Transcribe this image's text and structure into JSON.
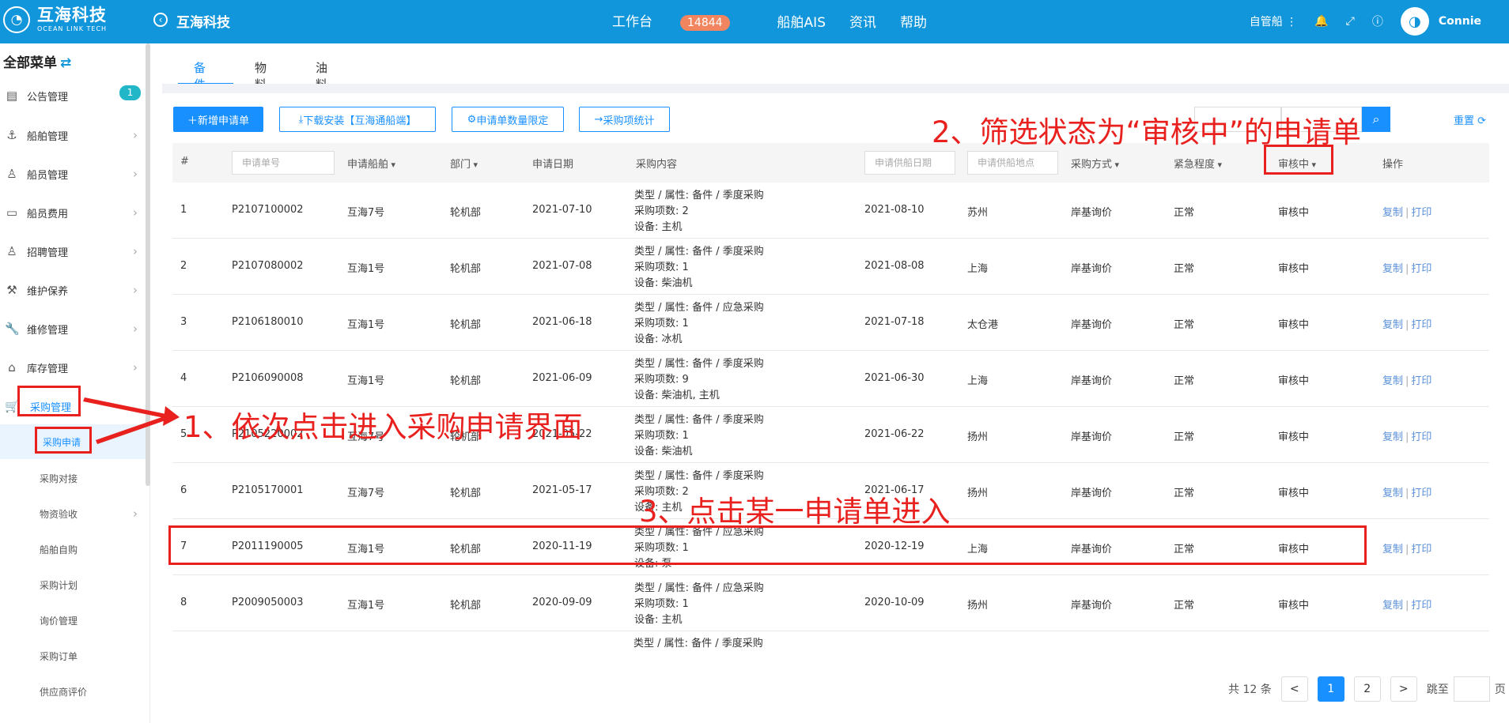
{
  "header": {
    "logo_cn": "互海科技",
    "logo_en": "OCEAN LINK TECH",
    "company": "互海科技",
    "nav": {
      "workbench": "工作台",
      "workbench_badge": "14844",
      "ais": "船舶AIS",
      "news": "资讯",
      "help": "帮助"
    },
    "tool": "自管船",
    "user": "Connie"
  },
  "sidebar": {
    "title": "全部菜单",
    "items": [
      {
        "label": "公告管理",
        "count": "1"
      },
      {
        "label": "船舶管理"
      },
      {
        "label": "船员管理"
      },
      {
        "label": "船员费用"
      },
      {
        "label": "招聘管理"
      },
      {
        "label": "维护保养"
      },
      {
        "label": "维修管理"
      },
      {
        "label": "库存管理"
      },
      {
        "label": "采购管理"
      }
    ],
    "subitems": [
      "采购申请",
      "采购对接",
      "物资验收",
      "船舶自购",
      "采购计划",
      "询价管理",
      "采购订单",
      "供应商评价"
    ]
  },
  "tabs": [
    "备件",
    "物料",
    "油料"
  ],
  "toolbar": {
    "new": "新增申请单",
    "download": "下载安装【互海通船端】",
    "limit": "申请单数量限定",
    "stats": "采购项统计",
    "reset": "重置"
  },
  "table": {
    "headers": {
      "index": "#",
      "order_placeholder": "申请单号",
      "ship": "申请船舶",
      "dept": "部门",
      "date": "申请日期",
      "content": "采购内容",
      "supply_date_placeholder": "申请供船日期",
      "supply_place_placeholder": "申请供船地点",
      "method": "采购方式",
      "urgency": "紧急程度",
      "status": "审核中",
      "ops": "操作"
    },
    "rows": [
      {
        "index": "1",
        "order": "P2107100002",
        "ship": "互海7号",
        "dept": "轮机部",
        "date": "2021-07-10",
        "c1": "类型 / 属性:  备件 / 季度采购",
        "c2": "采购项数:  2",
        "c3": "设备:   主机",
        "supply_date": "2021-08-10",
        "place": "苏州",
        "method": "岸基询价",
        "urgency": "正常",
        "status": "审核中",
        "copy": "复制",
        "print": "打印"
      },
      {
        "index": "2",
        "order": "P2107080002",
        "ship": "互海1号",
        "dept": "轮机部",
        "date": "2021-07-08",
        "c1": "类型 / 属性:  备件 / 季度采购",
        "c2": "采购项数:  1",
        "c3": "设备:   柴油机",
        "supply_date": "2021-08-08",
        "place": "上海",
        "method": "岸基询价",
        "urgency": "正常",
        "status": "审核中",
        "copy": "复制",
        "print": "打印"
      },
      {
        "index": "3",
        "order": "P2106180010",
        "ship": "互海1号",
        "dept": "轮机部",
        "date": "2021-06-18",
        "c1": "类型 / 属性:  备件 / 应急采购",
        "c2": "采购项数:  1",
        "c3": "设备:   冰机",
        "supply_date": "2021-07-18",
        "place": "太仓港",
        "method": "岸基询价",
        "urgency": "正常",
        "status": "审核中",
        "copy": "复制",
        "print": "打印"
      },
      {
        "index": "4",
        "order": "P2106090008",
        "ship": "互海1号",
        "dept": "轮机部",
        "date": "2021-06-09",
        "c1": "类型 / 属性:  备件 / 季度采购",
        "c2": "采购项数:  9",
        "c3": "设备:   柴油机, 主机",
        "supply_date": "2021-06-30",
        "place": "上海",
        "method": "岸基询价",
        "urgency": "正常",
        "status": "审核中",
        "copy": "复制",
        "print": "打印"
      },
      {
        "index": "5",
        "order": "P2105220002",
        "ship": "互海7号",
        "dept": "轮机部",
        "date": "2021-05-22",
        "c1": "类型 / 属性:  备件 / 季度采购",
        "c2": "采购项数:  1",
        "c3": "设备:   柴油机",
        "supply_date": "2021-06-22",
        "place": "扬州",
        "method": "岸基询价",
        "urgency": "正常",
        "status": "审核中",
        "copy": "复制",
        "print": "打印"
      },
      {
        "index": "6",
        "order": "P2105170001",
        "ship": "互海7号",
        "dept": "轮机部",
        "date": "2021-05-17",
        "c1": "类型 / 属性:  备件 / 季度采购",
        "c2": "采购项数:  2",
        "c3": "设备:   主机",
        "supply_date": "2021-06-17",
        "place": "扬州",
        "method": "岸基询价",
        "urgency": "正常",
        "status": "审核中",
        "copy": "复制",
        "print": "打印"
      },
      {
        "index": "7",
        "order": "P2011190005",
        "ship": "互海1号",
        "dept": "轮机部",
        "date": "2020-11-19",
        "c1": "类型 / 属性:  备件 / 应急采购",
        "c2": "采购项数:  1",
        "c3": "设备:   泵",
        "supply_date": "2020-12-19",
        "place": "上海",
        "method": "岸基询价",
        "urgency": "正常",
        "status": "审核中",
        "copy": "复制",
        "print": "打印"
      },
      {
        "index": "8",
        "order": "P2009050003",
        "ship": "互海1号",
        "dept": "轮机部",
        "date": "2020-09-09",
        "c1": "类型 / 属性:  备件 / 应急采购",
        "c2": "采购项数:  1",
        "c3": "设备:   主机",
        "supply_date": "2020-10-09",
        "place": "扬州",
        "method": "岸基询价",
        "urgency": "正常",
        "status": "审核中",
        "copy": "复制",
        "print": "打印"
      }
    ],
    "partial_content": "类型 / 属性:  备件 / 季度采购"
  },
  "pagination": {
    "total": "共 12 条",
    "prev": "<",
    "pages": [
      "1",
      "2"
    ],
    "next": ">",
    "jump": "跳至",
    "page_unit": "页"
  },
  "annotations": {
    "step1": "1、依次点击进入采购申请界面",
    "step2": "2、筛选状态为“审核中”的申请单",
    "step3": "3、点击某一申请单进入"
  }
}
